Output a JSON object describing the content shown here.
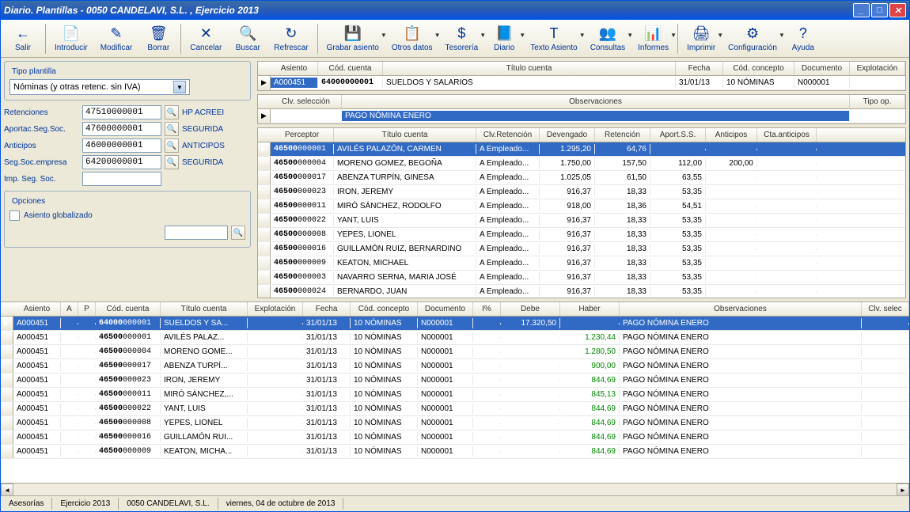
{
  "window_title": "Diario. Plantillas - 0050 CANDELAVI, S.L. , Ejercicio 2013",
  "toolbar": [
    {
      "label": "Salir",
      "icon": "←"
    },
    {
      "label": "Introducir",
      "icon": "📄"
    },
    {
      "label": "Modificar",
      "icon": "✎"
    },
    {
      "label": "Borrar",
      "icon": "🗑"
    },
    {
      "label": "Cancelar",
      "icon": "✕"
    },
    {
      "label": "Buscar",
      "icon": "🔍"
    },
    {
      "label": "Refrescar",
      "icon": "↻"
    },
    {
      "label": "Grabar asiento",
      "icon": "💾"
    },
    {
      "label": "Otros datos",
      "icon": "📋"
    },
    {
      "label": "Tesorería",
      "icon": "$"
    },
    {
      "label": "Diario",
      "icon": "📘"
    },
    {
      "label": "Texto Asiento",
      "icon": "T"
    },
    {
      "label": "Consultas",
      "icon": "👥"
    },
    {
      "label": "Informes",
      "icon": "📊"
    },
    {
      "label": "Imprimir",
      "icon": "🖨"
    },
    {
      "label": "Configuración",
      "icon": "⚙"
    },
    {
      "label": "Ayuda",
      "icon": "?"
    }
  ],
  "tipo_plantilla": {
    "label": "Tipo plantilla",
    "value": "Nóminas (y otras retenc. sin IVA)"
  },
  "form": {
    "retenciones": {
      "label": "Retenciones",
      "value": "47510000001",
      "desc": "HP ACREEI"
    },
    "aportac": {
      "label": "Aportac.Seg.Soc.",
      "value": "47600000001",
      "desc": "SEGURIDA"
    },
    "anticipos": {
      "label": "Anticipos",
      "value": "46000000001",
      "desc": "ANTICIPOS"
    },
    "segsoc": {
      "label": "Seg.Soc.empresa",
      "value": "64200000001",
      "desc": "SEGURIDA"
    },
    "impsegsoc": {
      "label": "Imp. Seg. Soc.",
      "value": ""
    }
  },
  "opciones": {
    "label": "Opciones",
    "chk": "Asiento globalizado"
  },
  "asiento_grid": {
    "headers": [
      "Asiento",
      "Cód. cuenta",
      "Título cuenta",
      "Fecha",
      "Cód. concepto",
      "Documento",
      "Explotación"
    ],
    "row": {
      "asiento": "A000451",
      "cuenta": "64000000001",
      "titulo": "SUELDOS Y SALARIOS",
      "fecha": "31/01/13",
      "concepto": "10 NÓMINAS",
      "doc": "N000001",
      "expl": ""
    }
  },
  "obs_grid": {
    "headers": [
      "Clv. selección",
      "Observaciones",
      "Tipo op."
    ],
    "row": {
      "clv": "",
      "obs": "PAGO NÓMINA ENERO",
      "tipo": ""
    }
  },
  "perceptor_grid": {
    "headers": [
      "Perceptor",
      "Título cuenta",
      "Clv.Retención",
      "Devengado",
      "Retención",
      "Aport.S.S.",
      "Anticipos",
      "Cta.anticipos"
    ],
    "rows": [
      {
        "p": "46500000001",
        "t": "AVILÉS PALAZÓN, CARMEN",
        "c": "A Empleado...",
        "d": "1.295,20",
        "r": "64,76",
        "a": "",
        "an": "",
        "ca": ""
      },
      {
        "p": "46500000004",
        "t": "MORENO GOMEZ, BEGOÑA",
        "c": "A Empleado...",
        "d": "1.750,00",
        "r": "157,50",
        "a": "112,00",
        "an": "200,00",
        "ca": ""
      },
      {
        "p": "46500000017",
        "t": "ABENZA TURPÍN, GINESA",
        "c": "A Empleado...",
        "d": "1.025,05",
        "r": "61,50",
        "a": "63,55",
        "an": "",
        "ca": ""
      },
      {
        "p": "46500000023",
        "t": "IRON, JEREMY",
        "c": "A Empleado...",
        "d": "916,37",
        "r": "18,33",
        "a": "53,35",
        "an": "",
        "ca": ""
      },
      {
        "p": "46500000011",
        "t": "MIRÓ SÁNCHEZ, RODOLFO",
        "c": "A Empleado...",
        "d": "918,00",
        "r": "18,36",
        "a": "54,51",
        "an": "",
        "ca": ""
      },
      {
        "p": "46500000022",
        "t": "YANT, LUIS",
        "c": "A Empleado...",
        "d": "916,37",
        "r": "18,33",
        "a": "53,35",
        "an": "",
        "ca": ""
      },
      {
        "p": "46500000008",
        "t": "YEPES, LIONEL",
        "c": "A Empleado...",
        "d": "916,37",
        "r": "18,33",
        "a": "53,35",
        "an": "",
        "ca": ""
      },
      {
        "p": "46500000016",
        "t": "GUILLAMÓN RUIZ, BERNARDINO",
        "c": "A Empleado...",
        "d": "916,37",
        "r": "18,33",
        "a": "53,35",
        "an": "",
        "ca": ""
      },
      {
        "p": "46500000009",
        "t": "KEATON, MICHAEL",
        "c": "A Empleado...",
        "d": "916,37",
        "r": "18,33",
        "a": "53,35",
        "an": "",
        "ca": ""
      },
      {
        "p": "46500000003",
        "t": "NAVARRO SERNA, MARIA JOSÉ",
        "c": "A Empleado...",
        "d": "916,37",
        "r": "18,33",
        "a": "53,35",
        "an": "",
        "ca": ""
      },
      {
        "p": "46500000024",
        "t": "BERNARDO, JUAN",
        "c": "A Empleado...",
        "d": "916,37",
        "r": "18,33",
        "a": "53,35",
        "an": "",
        "ca": ""
      }
    ]
  },
  "lower_grid": {
    "headers": [
      "Asiento",
      "A",
      "P",
      "Cód. cuenta",
      "Título cuenta",
      "Explotación",
      "Fecha",
      "Cód. concepto",
      "Documento",
      "I%",
      "Debe",
      "Haber",
      "Observaciones",
      "Clv. selec"
    ],
    "rows": [
      {
        "as": "A000451",
        "a": "",
        "p": "",
        "cc": "64000000001",
        "tc": "SUELDOS Y SA...",
        "ex": "",
        "fe": "31/01/13",
        "co": "10 NÓMINAS",
        "do": "N000001",
        "i": "",
        "de": "17.320,50",
        "ha": "",
        "ob": "PAGO NÓMINA ENERO",
        "sel": true
      },
      {
        "as": "A000451",
        "a": "",
        "p": "",
        "cc": "46500000001",
        "tc": "AVILÉS PALAZ...",
        "ex": "",
        "fe": "31/01/13",
        "co": "10 NÓMINAS",
        "do": "N000001",
        "i": "",
        "de": "",
        "ha": "1.230,44",
        "ob": "PAGO NÓMINA ENERO"
      },
      {
        "as": "A000451",
        "a": "",
        "p": "",
        "cc": "46500000004",
        "tc": "MORENO GOME...",
        "ex": "",
        "fe": "31/01/13",
        "co": "10 NÓMINAS",
        "do": "N000001",
        "i": "",
        "de": "",
        "ha": "1.280,50",
        "ob": "PAGO NÓMINA ENERO"
      },
      {
        "as": "A000451",
        "a": "",
        "p": "",
        "cc": "46500000017",
        "tc": "ABENZA TURPÍ...",
        "ex": "",
        "fe": "31/01/13",
        "co": "10 NÓMINAS",
        "do": "N000001",
        "i": "",
        "de": "",
        "ha": "900,00",
        "ob": "PAGO NÓMINA ENERO"
      },
      {
        "as": "A000451",
        "a": "",
        "p": "",
        "cc": "46500000023",
        "tc": "IRON, JEREMY",
        "ex": "",
        "fe": "31/01/13",
        "co": "10 NÓMINAS",
        "do": "N000001",
        "i": "",
        "de": "",
        "ha": "844,69",
        "ob": "PAGO NÓMINA ENERO"
      },
      {
        "as": "A000451",
        "a": "",
        "p": "",
        "cc": "46500000011",
        "tc": "MIRÓ SÁNCHEZ,...",
        "ex": "",
        "fe": "31/01/13",
        "co": "10 NÓMINAS",
        "do": "N000001",
        "i": "",
        "de": "",
        "ha": "845,13",
        "ob": "PAGO NÓMINA ENERO"
      },
      {
        "as": "A000451",
        "a": "",
        "p": "",
        "cc": "46500000022",
        "tc": "YANT, LUIS",
        "ex": "",
        "fe": "31/01/13",
        "co": "10 NÓMINAS",
        "do": "N000001",
        "i": "",
        "de": "",
        "ha": "844,69",
        "ob": "PAGO NÓMINA ENERO"
      },
      {
        "as": "A000451",
        "a": "",
        "p": "",
        "cc": "46500000008",
        "tc": "YEPES, LIONEL",
        "ex": "",
        "fe": "31/01/13",
        "co": "10 NÓMINAS",
        "do": "N000001",
        "i": "",
        "de": "",
        "ha": "844,69",
        "ob": "PAGO NÓMINA ENERO"
      },
      {
        "as": "A000451",
        "a": "",
        "p": "",
        "cc": "46500000016",
        "tc": "GUILLAMÓN RUI...",
        "ex": "",
        "fe": "31/01/13",
        "co": "10 NÓMINAS",
        "do": "N000001",
        "i": "",
        "de": "",
        "ha": "844,69",
        "ob": "PAGO NÓMINA ENERO"
      },
      {
        "as": "A000451",
        "a": "",
        "p": "",
        "cc": "46500000009",
        "tc": "KEATON, MICHA...",
        "ex": "",
        "fe": "31/01/13",
        "co": "10 NÓMINAS",
        "do": "N000001",
        "i": "",
        "de": "",
        "ha": "844,69",
        "ob": "PAGO NÓMINA ENERO"
      }
    ]
  },
  "statusbar": [
    "Asesorías",
    "Ejercicio 2013",
    "0050 CANDELAVI, S.L.",
    "viernes, 04 de octubre de 2013"
  ]
}
